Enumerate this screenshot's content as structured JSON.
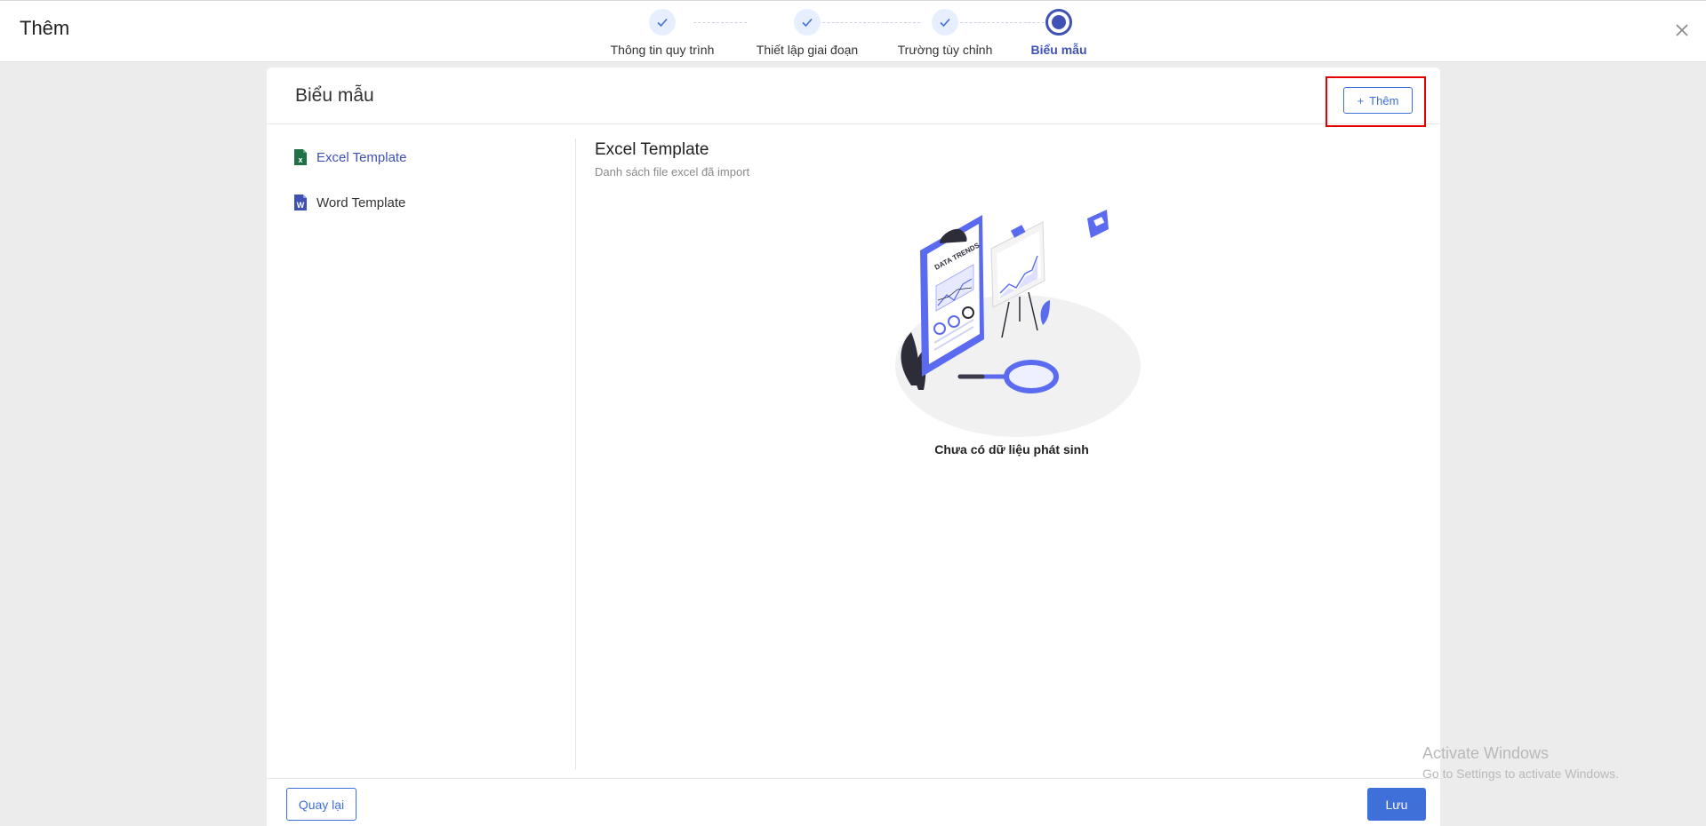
{
  "header": {
    "title": "Thêm"
  },
  "stepper": {
    "steps": [
      {
        "label": "Thông tin quy trình",
        "state": "done"
      },
      {
        "label": "Thiết lập giai đoạn",
        "state": "done"
      },
      {
        "label": "Trường tùy chỉnh",
        "state": "done"
      },
      {
        "label": "Biểu mẫu",
        "state": "active"
      }
    ]
  },
  "card": {
    "title": "Biểu mẫu",
    "add_button_label": "Thêm"
  },
  "sidebar": {
    "items": [
      {
        "label": "Excel Template",
        "icon": "excel-file-icon",
        "active": true
      },
      {
        "label": "Word Template",
        "icon": "word-file-icon",
        "active": false
      }
    ]
  },
  "content": {
    "title": "Excel Template",
    "subtitle": "Danh sách file excel đã import",
    "empty_message": "Chưa có dữ liệu phát sinh",
    "illustration_text": "DATA TRENDS"
  },
  "footer": {
    "back_label": "Quay lại",
    "save_label": "Lưu"
  },
  "watermark": {
    "title": "Activate Windows",
    "subtitle": "Go to Settings to activate Windows."
  },
  "colors": {
    "accent": "#3f6fd8",
    "active_step": "#3f51b5",
    "highlight": "#e60000",
    "excel_green": "#1e7145",
    "word_blue": "#3f51b5"
  }
}
